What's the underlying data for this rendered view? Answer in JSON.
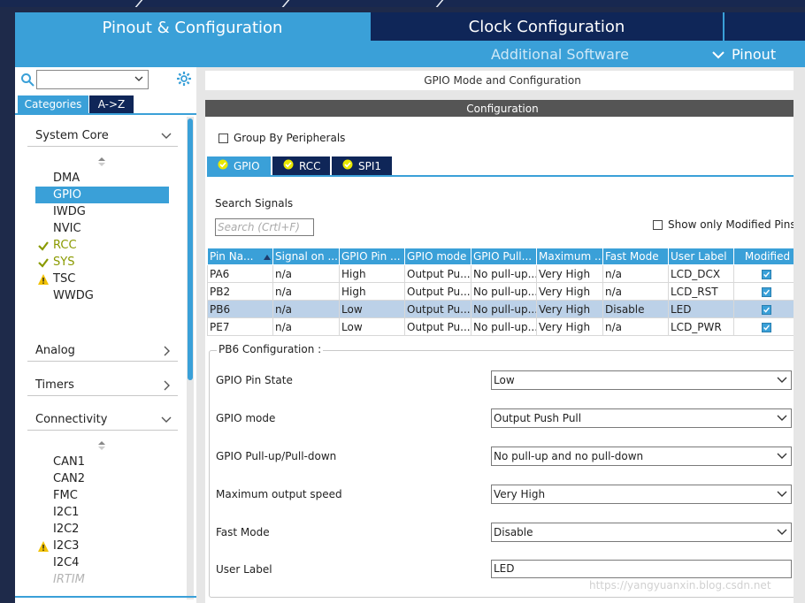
{
  "header": {
    "tab_pinout_config": "Pinout & Configuration",
    "tab_clock_config": "Clock Configuration",
    "additional_software": "Additional Software",
    "pinout_menu": "Pinout"
  },
  "sidebar": {
    "tabs": [
      "Categories",
      "A->Z"
    ],
    "sections": {
      "system_core": "System Core",
      "analog": "Analog",
      "timers": "Timers",
      "connectivity": "Connectivity"
    },
    "system_core_items": [
      {
        "label": "DMA",
        "status": "none"
      },
      {
        "label": "GPIO",
        "status": "selected"
      },
      {
        "label": "IWDG",
        "status": "none"
      },
      {
        "label": "NVIC",
        "status": "none"
      },
      {
        "label": "RCC",
        "status": "ok"
      },
      {
        "label": "SYS",
        "status": "ok"
      },
      {
        "label": "TSC",
        "status": "warning"
      },
      {
        "label": "WWDG",
        "status": "none"
      }
    ],
    "connectivity_items": [
      {
        "label": "CAN1",
        "status": "none"
      },
      {
        "label": "CAN2",
        "status": "none"
      },
      {
        "label": "FMC",
        "status": "none"
      },
      {
        "label": "I2C1",
        "status": "none"
      },
      {
        "label": "I2C2",
        "status": "none"
      },
      {
        "label": "I2C3",
        "status": "warning"
      },
      {
        "label": "I2C4",
        "status": "none"
      },
      {
        "label": "IRTIM",
        "status": "disabled"
      }
    ]
  },
  "main": {
    "mode_title": "GPIO Mode and Configuration",
    "configuration_title": "Configuration",
    "group_by_peripherals": "Group By Peripherals",
    "peripheral_tabs": [
      "GPIO",
      "RCC",
      "SPI1"
    ],
    "search_signals_label": "Search Signals",
    "search_placeholder": "Search (Crtl+F)",
    "show_only_modified": "Show only Modified Pins",
    "table": {
      "columns": [
        "Pin Na...",
        "Signal on ...",
        "GPIO Pin ...",
        "GPIO mode",
        "GPIO Pull...",
        "Maximum ...",
        "Fast Mode",
        "User Label",
        "Modified"
      ],
      "rows": [
        [
          "PA6",
          "n/a",
          "High",
          "Output Pu...",
          "No pull-up...",
          "Very High",
          "n/a",
          "LCD_DCX"
        ],
        [
          "PB2",
          "n/a",
          "High",
          "Output Pu...",
          "No pull-up...",
          "Very High",
          "n/a",
          "LCD_RST"
        ],
        [
          "PB6",
          "n/a",
          "Low",
          "Output Pu...",
          "No pull-up...",
          "Very High",
          "Disable",
          "LED"
        ],
        [
          "PE7",
          "n/a",
          "Low",
          "Output Pu...",
          "No pull-up...",
          "Very High",
          "n/a",
          "LCD_PWR"
        ]
      ],
      "selected_row": 2,
      "modified": [
        true,
        true,
        true,
        true
      ]
    },
    "pb6": {
      "title": "PB6 Configuration :",
      "pin_state_label": "GPIO Pin State",
      "pin_state_value": "Low",
      "mode_label": "GPIO mode",
      "mode_value": "Output Push Pull",
      "pull_label": "GPIO Pull-up/Pull-down",
      "pull_value": "No pull-up and no pull-down",
      "speed_label": "Maximum output speed",
      "speed_value": "Very High",
      "fast_label": "Fast Mode",
      "fast_value": "Disable",
      "user_label_label": "User Label",
      "user_label_value": "LED"
    }
  },
  "watermark": "https://yangyuanxin.blog.csdn.net",
  "colors": {
    "accent": "#3aa0d8",
    "dark_navy": "#0f2658",
    "ok_green": "#8a9a00",
    "warning_yellow": "#f2c200"
  }
}
